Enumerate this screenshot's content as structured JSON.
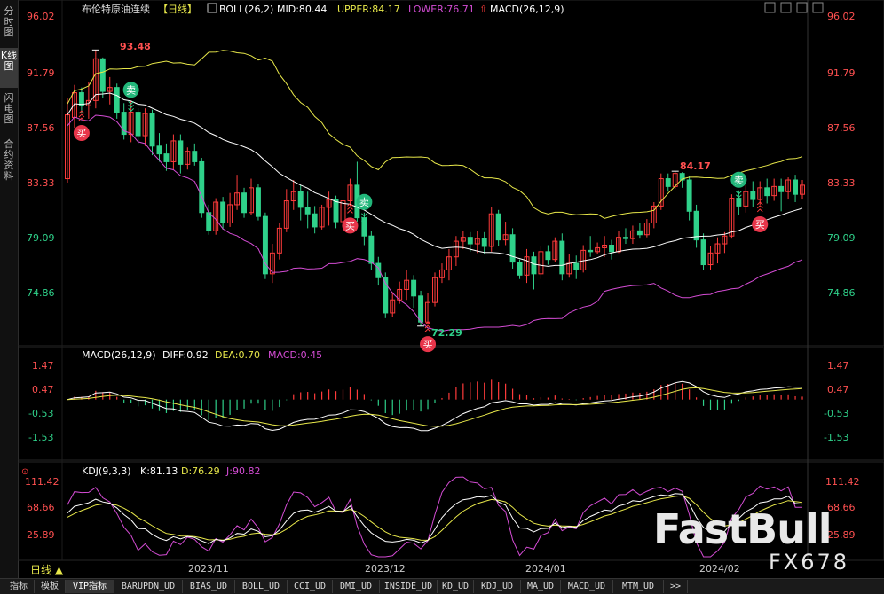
{
  "sidebar": {
    "tabs": [
      {
        "label": "分时图",
        "active": false
      },
      {
        "label": "K线图",
        "active": true
      },
      {
        "label": "闪电图",
        "active": false
      },
      {
        "label": "合约资料",
        "active": false
      }
    ]
  },
  "main_panel": {
    "instrument": "布伦特原油连续",
    "period_tag": "【日线】",
    "boll": {
      "name": "BOLL(26,2)",
      "mid": "MID:80.44",
      "upper": "UPPER:84.17",
      "lower": "LOWER:76.71"
    },
    "macd_label": "MACD(26,12,9)",
    "yticks": [
      "96.02",
      "91.79",
      "87.56",
      "83.33",
      "79.09",
      "74.86"
    ],
    "high_label": "93.48",
    "low_label": "72.29",
    "recent_high_label": "84.17",
    "signal_buy": "买",
    "signal_sell": "卖"
  },
  "macd_panel": {
    "title": "MACD(26,12,9)",
    "diff": "DIFF:0.92",
    "dea": "DEA:0.70",
    "macd": "MACD:0.45",
    "yticks": [
      "1.47",
      "0.47",
      "-0.53",
      "-1.53"
    ]
  },
  "kdj_panel": {
    "title": "KDJ(9,3,3)",
    "k": "K:81.13",
    "d": "D:76.29",
    "j": "J:90.82",
    "yticks": [
      "111.42",
      "68.66",
      "25.89"
    ]
  },
  "xaxis": {
    "labels": [
      "2023/11",
      "2023/12",
      "2024/01",
      "2024/02"
    ],
    "period": "日线 ▲"
  },
  "bottom_tabs": [
    "指标",
    "模板",
    "VIP指标",
    "BARUPDN_UD",
    "BIAS_UD",
    "BOLL_UD",
    "CCI_UD",
    "DMI_UD",
    "INSIDE_UD",
    "KD_UD",
    "KDJ_UD",
    "MA_UD",
    "MACD_UD",
    "MTM_UD",
    ">>"
  ],
  "watermark": {
    "logo": "FastBull",
    "code": "FX678"
  },
  "colors": {
    "up": "#ff3b3b",
    "down": "#2fd18a",
    "mid": "#ffffff",
    "upper": "#e8e84a",
    "lower": "#d44cd4",
    "diff": "#ffffff",
    "dea": "#e8e84a",
    "k": "#ffffff",
    "d": "#e8e84a",
    "j": "#d44cd4"
  },
  "chart_data": {
    "type": "candlestick",
    "title": "布伦特原油连续 日线",
    "ylim": [
      72.0,
      96.5
    ],
    "candles": [
      [
        83.6,
        88.5,
        83.3,
        89.8
      ],
      [
        88.3,
        90.2,
        87.5,
        90.8
      ],
      [
        90.2,
        89.2,
        88.6,
        90.6
      ],
      [
        89.2,
        89.6,
        88.2,
        91.0
      ],
      [
        89.6,
        92.8,
        89.0,
        93.48
      ],
      [
        92.8,
        90.3,
        89.8,
        92.9
      ],
      [
        90.3,
        90.6,
        89.3,
        91.4
      ],
      [
        90.6,
        88.7,
        88.2,
        90.9
      ],
      [
        88.7,
        87.0,
        86.6,
        89.4
      ],
      [
        87.0,
        88.7,
        86.4,
        89.6
      ],
      [
        88.7,
        86.9,
        86.3,
        89.0
      ],
      [
        86.9,
        88.6,
        86.1,
        89.0
      ],
      [
        88.6,
        86.1,
        85.4,
        88.9
      ],
      [
        86.1,
        85.5,
        84.9,
        87.1
      ],
      [
        85.5,
        84.9,
        84.2,
        86.3
      ],
      [
        84.9,
        86.5,
        84.3,
        87.0
      ],
      [
        86.5,
        84.7,
        84.0,
        87.0
      ],
      [
        84.7,
        85.7,
        84.3,
        86.0
      ],
      [
        85.7,
        84.9,
        84.6,
        86.3
      ],
      [
        84.9,
        81.0,
        80.6,
        85.2
      ],
      [
        81.0,
        79.6,
        79.3,
        81.6
      ],
      [
        79.6,
        81.8,
        79.3,
        82.1
      ],
      [
        81.8,
        80.2,
        79.7,
        82.2
      ],
      [
        80.2,
        81.6,
        79.9,
        82.5
      ],
      [
        81.6,
        82.5,
        81.2,
        83.9
      ],
      [
        82.5,
        81.0,
        80.6,
        82.9
      ],
      [
        81.0,
        82.9,
        80.8,
        83.6
      ],
      [
        82.9,
        80.7,
        80.4,
        83.2
      ],
      [
        80.7,
        76.3,
        75.9,
        81.0
      ],
      [
        76.3,
        77.9,
        75.6,
        78.6
      ],
      [
        77.9,
        79.8,
        77.4,
        80.2
      ],
      [
        79.8,
        81.9,
        79.5,
        82.8
      ],
      [
        81.9,
        82.6,
        81.2,
        83.5
      ],
      [
        82.6,
        81.4,
        80.4,
        83.1
      ],
      [
        81.4,
        80.9,
        79.8,
        82.6
      ],
      [
        80.9,
        79.9,
        79.4,
        81.5
      ],
      [
        79.9,
        81.4,
        79.7,
        81.6
      ],
      [
        81.4,
        82.0,
        80.0,
        82.6
      ],
      [
        82.0,
        80.3,
        79.8,
        82.3
      ],
      [
        80.3,
        81.9,
        80.0,
        82.2
      ],
      [
        81.9,
        83.1,
        81.5,
        83.6
      ],
      [
        83.1,
        80.6,
        80.3,
        84.9
      ],
      [
        80.6,
        79.2,
        78.5,
        81.0
      ],
      [
        79.2,
        77.1,
        76.6,
        79.6
      ],
      [
        77.1,
        76.0,
        75.4,
        77.6
      ],
      [
        76.0,
        73.3,
        72.9,
        76.4
      ],
      [
        73.3,
        74.3,
        73.0,
        74.9
      ],
      [
        74.3,
        75.1,
        74.0,
        75.7
      ],
      [
        75.1,
        75.8,
        74.3,
        76.6
      ],
      [
        75.8,
        74.6,
        73.7,
        76.2
      ],
      [
        74.6,
        72.6,
        72.29,
        75.0
      ],
      [
        72.6,
        74.1,
        72.4,
        74.8
      ],
      [
        74.1,
        76.0,
        73.8,
        76.4
      ],
      [
        76.0,
        76.6,
        75.6,
        77.1
      ],
      [
        76.6,
        77.6,
        75.8,
        78.2
      ],
      [
        77.6,
        78.8,
        76.9,
        79.2
      ],
      [
        78.8,
        79.1,
        78.2,
        79.6
      ],
      [
        79.1,
        78.6,
        78.0,
        79.5
      ],
      [
        78.6,
        79.0,
        77.9,
        79.6
      ],
      [
        79.0,
        78.4,
        77.8,
        79.5
      ],
      [
        78.4,
        80.9,
        78.0,
        81.4
      ],
      [
        80.9,
        78.9,
        78.4,
        81.2
      ],
      [
        78.9,
        79.3,
        78.5,
        80.3
      ],
      [
        79.3,
        77.2,
        76.7,
        79.8
      ],
      [
        77.2,
        76.2,
        75.9,
        77.4
      ],
      [
        76.2,
        77.6,
        75.6,
        78.2
      ],
      [
        77.6,
        76.3,
        75.1,
        78.0
      ],
      [
        76.3,
        78.0,
        75.9,
        78.4
      ],
      [
        78.0,
        77.4,
        77.0,
        78.5
      ],
      [
        77.4,
        78.8,
        77.2,
        79.1
      ],
      [
        78.8,
        76.3,
        75.8,
        79.4
      ],
      [
        76.3,
        77.1,
        76.0,
        77.8
      ],
      [
        77.1,
        76.6,
        75.9,
        77.7
      ],
      [
        76.6,
        78.1,
        76.4,
        78.5
      ],
      [
        78.1,
        78.0,
        77.6,
        79.2
      ],
      [
        78.0,
        78.3,
        77.8,
        78.7
      ],
      [
        78.3,
        78.5,
        77.6,
        79.2
      ],
      [
        78.5,
        78.0,
        77.4,
        78.9
      ],
      [
        78.0,
        79.1,
        77.9,
        79.6
      ],
      [
        79.1,
        79.0,
        78.6,
        79.8
      ],
      [
        79.0,
        79.6,
        78.6,
        80.0
      ],
      [
        79.6,
        79.3,
        79.0,
        80.2
      ],
      [
        79.3,
        80.2,
        79.1,
        80.5
      ],
      [
        80.2,
        81.5,
        79.8,
        81.8
      ],
      [
        81.5,
        83.6,
        81.2,
        84.0
      ],
      [
        83.6,
        83.0,
        82.6,
        84.0
      ],
      [
        83.0,
        84.0,
        82.8,
        84.17
      ],
      [
        84.0,
        83.5,
        82.9,
        84.1
      ],
      [
        83.5,
        81.1,
        80.4,
        83.8
      ],
      [
        81.1,
        78.9,
        78.3,
        81.6
      ],
      [
        78.9,
        77.0,
        76.6,
        79.4
      ],
      [
        77.0,
        77.9,
        76.6,
        78.4
      ],
      [
        77.9,
        78.6,
        77.1,
        79.1
      ],
      [
        78.6,
        79.2,
        77.9,
        79.5
      ],
      [
        79.2,
        82.1,
        79.0,
        82.4
      ],
      [
        82.1,
        81.5,
        80.8,
        82.7
      ],
      [
        81.5,
        82.6,
        81.0,
        83.1
      ],
      [
        82.6,
        82.0,
        81.4,
        83.4
      ],
      [
        82.0,
        82.9,
        81.6,
        83.4
      ],
      [
        82.9,
        82.3,
        81.7,
        83.6
      ],
      [
        82.3,
        83.0,
        81.9,
        83.6
      ],
      [
        83.0,
        82.6,
        81.1,
        83.6
      ],
      [
        82.6,
        83.5,
        82.0,
        83.7
      ],
      [
        83.5,
        82.4,
        81.8,
        83.9
      ],
      [
        82.4,
        83.1,
        82.0,
        83.5
      ]
    ],
    "buy_signals_index": [
      2,
      40,
      51,
      98
    ],
    "sell_signals_index": [
      9,
      42,
      95
    ],
    "boll_mid_last": 80.44,
    "boll_upper_last": 84.17,
    "boll_lower_last": 76.71,
    "macd_last": {
      "diff": 0.92,
      "dea": 0.7,
      "macd": 0.45
    },
    "kdj_last": {
      "k": 81.13,
      "d": 76.29,
      "j": 90.82
    }
  }
}
